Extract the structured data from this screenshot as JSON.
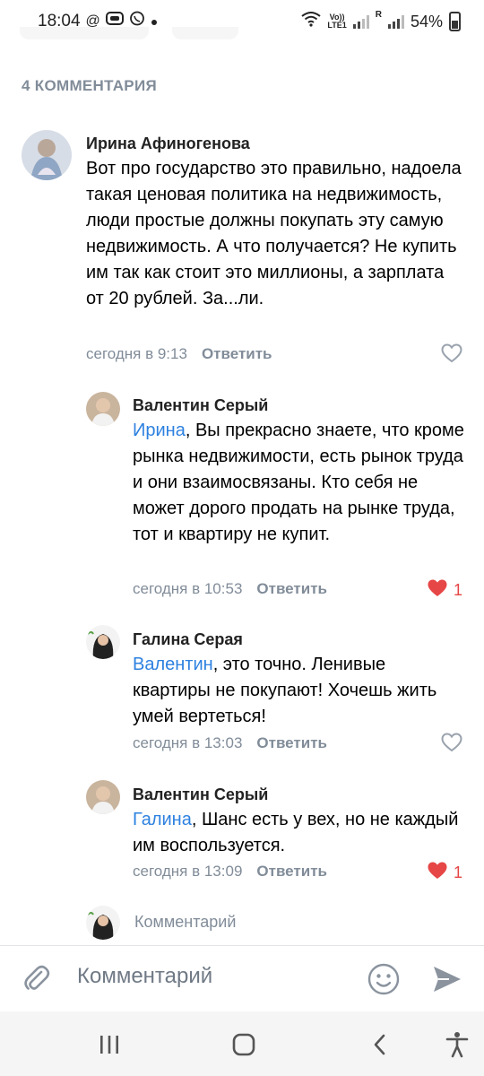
{
  "status_bar": {
    "time": "18:04",
    "left_icons": [
      "at-icon",
      "message-bubble-icon",
      "viber-icon",
      "dot-icon"
    ],
    "volte_top": "Vo))",
    "volte_bottom": "LTE1",
    "roaming_label": "R",
    "battery_percent": "54%"
  },
  "comments_header": "4 КОММЕНТАРИЯ",
  "comments": [
    {
      "author": "Ирина Афиногенова",
      "mention": "",
      "text": "Вот про государство это правильно, надоела такая ценовая политика на недвижимость, люди простые должны покупать эту самую недвижимость.  А что получается? Не купить им так как стоит это миллионы, а зарплата от 20 рублей.  За...ли.",
      "time": "сегодня в 9:13",
      "reply_label": "Ответить",
      "liked": false,
      "likes": ""
    },
    {
      "author": "Валентин Серый",
      "mention": "Ирина",
      "text": ", Вы прекрасно знаете, что кроме рынка недвижимости, есть рынок труда и они взаимосвязаны. Кто себя не может дорого продать на рынке труда, тот и квартиру не купит.",
      "time": "сегодня в 10:53",
      "reply_label": "Ответить",
      "liked": true,
      "likes": "1"
    },
    {
      "author": "Галина Серая",
      "mention": "Валентин",
      "text": ", это точно. Ленивые квартиры не покупают! Хочешь жить умей вертеться!",
      "time": "сегодня в 13:03",
      "reply_label": "Ответить",
      "liked": false,
      "likes": ""
    },
    {
      "author": "Валентин Серый",
      "mention": "Галина",
      "text": ", Шанс есть у вех, но не каждый им воспользуется.",
      "time": "сегодня в 13:09",
      "reply_label": "Ответить",
      "liked": true,
      "likes": "1"
    }
  ],
  "reply_composer": {
    "placeholder": "Комментарий"
  },
  "composer": {
    "placeholder": "Комментарий"
  },
  "nav_bar": [
    "recent-apps-icon",
    "home-icon",
    "back-icon",
    "accessibility-icon"
  ],
  "colors": {
    "accent": "#2d81e0",
    "secondary_text": "#818c99",
    "like_red": "#e64646"
  }
}
